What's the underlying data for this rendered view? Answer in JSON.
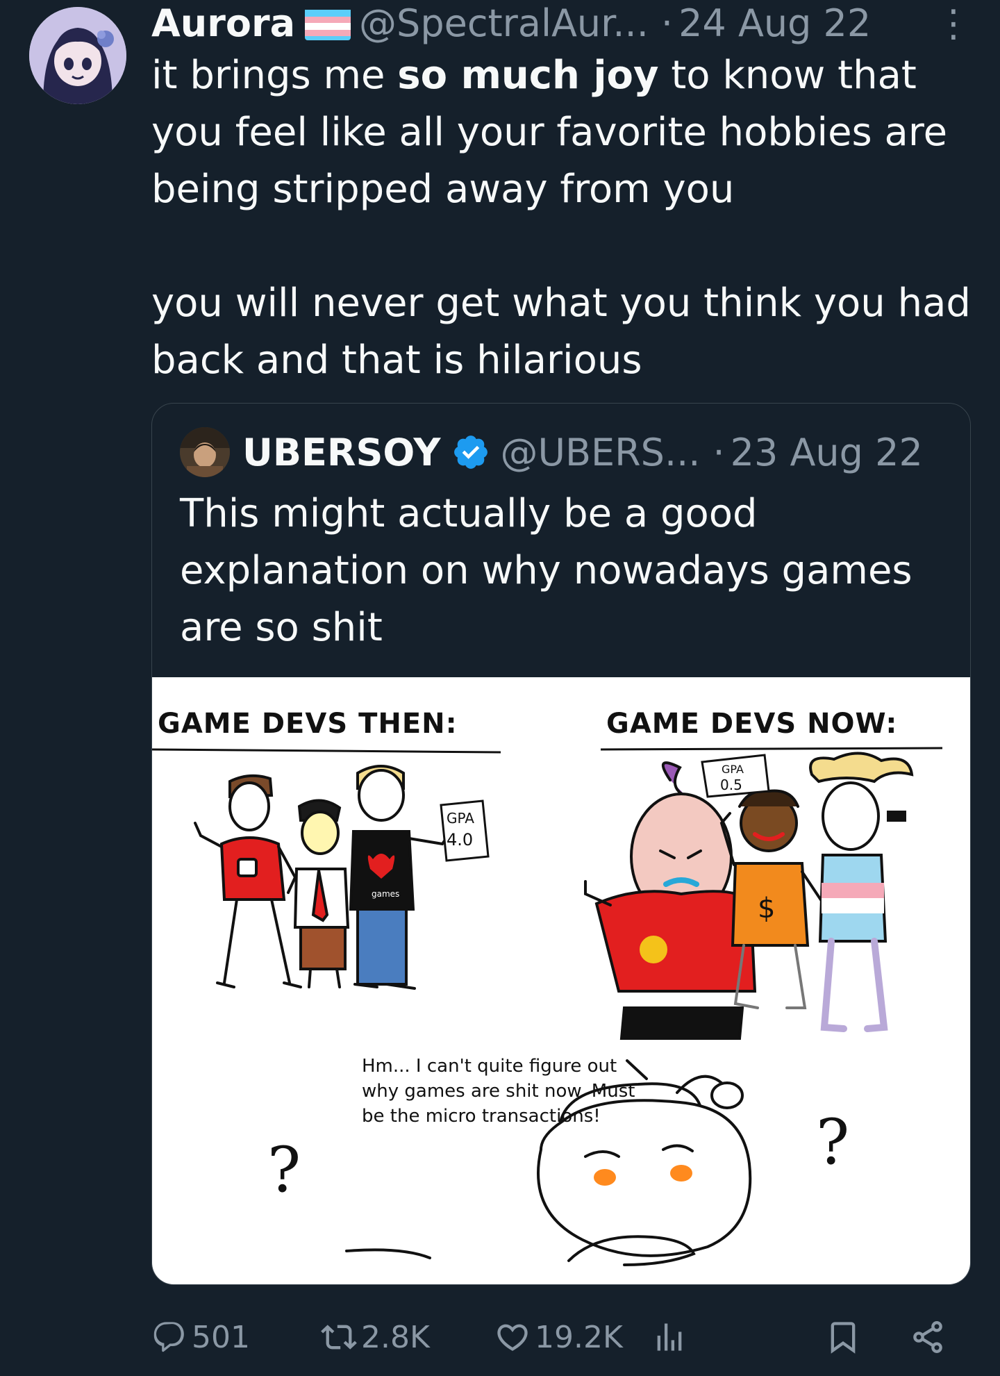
{
  "tweet": {
    "author_name": "Aurora",
    "author_handle": "@SpectralAur...",
    "separator": "·",
    "date": "24 Aug 22",
    "more_glyph": "⋮",
    "text_1_a": "it brings me ",
    "text_1_bold": "so much joy",
    "text_1_b": " to know that you feel like all your favorite hobbies are being stripped away from you",
    "text_2": "you will never get what you think you had back and that is hilarious"
  },
  "quote": {
    "author_name": "UBERSOY",
    "author_handle": "@UBERS...",
    "separator": "·",
    "date": "23 Aug 22",
    "text": "This might actually be a good explanation on why nowadays games are so shit",
    "meme": {
      "title_left": "GAME DEVS THEN:",
      "title_right": "GAME DEVS NOW:",
      "gpa_left_1": "GPA",
      "gpa_left_2": "4.0",
      "gpa_right_1": "GPA",
      "gpa_right_2": "0.5",
      "shirt_text": "games",
      "caption": "Hm... I can't quite figure out why games are shit now. Must be the micro transactions!",
      "question_left": "?",
      "question_right": "?"
    }
  },
  "actions": {
    "replies": "501",
    "retweets": "2.8K",
    "likes": "19.2K"
  },
  "colors": {
    "background": "#15202b",
    "text": "#f7f9f9",
    "muted": "#8b98a5",
    "verified": "#1d9bf0",
    "border": "#38444d"
  }
}
